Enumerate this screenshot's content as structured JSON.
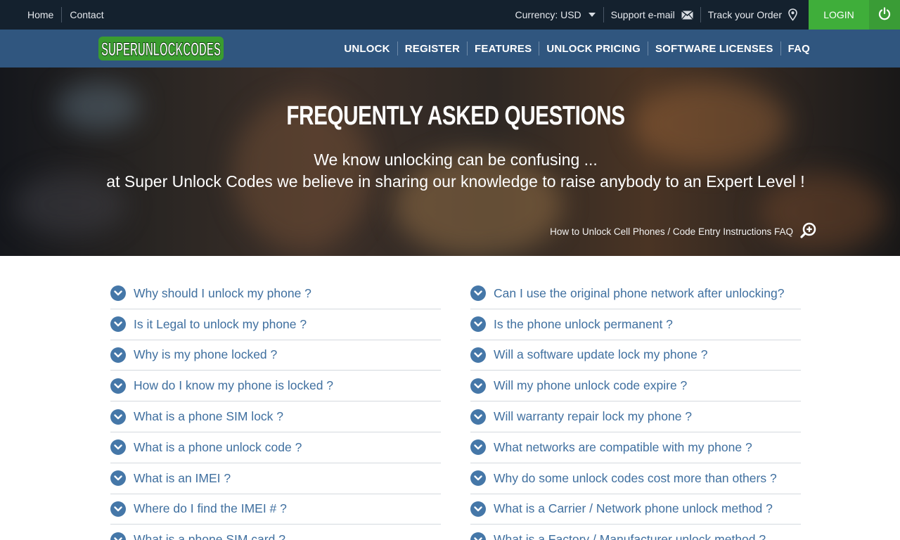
{
  "topbar": {
    "links": [
      "Home",
      "Contact"
    ],
    "currency_label": "Currency: USD",
    "support_label": "Support e-mail",
    "track_label": "Track your Order",
    "login_label": "LOGIN"
  },
  "brand": {
    "logo_text": "SUPERUNLOCKCODES"
  },
  "nav": {
    "items": [
      "UNLOCK",
      "REGISTER",
      "FEATURES",
      "UNLOCK PRICING",
      "SOFTWARE LICENSES",
      "FAQ"
    ]
  },
  "hero": {
    "title": "FREQUENTLY ASKED QUESTIONS",
    "subtitle_line1": "We know unlocking can be confusing ...",
    "subtitle_line2": "at Super Unlock Codes we believe in sharing our knowledge to raise anybody to an Expert Level !",
    "link_text": "How to Unlock Cell Phones / Code Entry Instructions FAQ"
  },
  "faq": {
    "left": [
      "Why should I unlock my phone ?",
      "Is it Legal to unlock my phone ?",
      "Why is my phone locked ?",
      "How do I know my phone is locked ?",
      "What is a phone SIM lock ?",
      "What is a phone unlock code ?",
      "What is an IMEI ?",
      "Where do I find the IMEI # ?",
      "What is a phone SIM card ?"
    ],
    "right": [
      "Can I use the original phone network after unlocking?",
      "Is the phone unlock permanent ?",
      "Will a software update lock my phone ?",
      "Will my phone unlock code expire ?",
      "Will warranty repair lock my phone ?",
      "What networks are compatible with my phone ?",
      "Why do some unlock codes cost more than others ?",
      "What is a Carrier / Network phone unlock method ?",
      "What is a Factory / Manufacturer unlock method ?"
    ]
  },
  "colors": {
    "topbar_bg": "#14212e",
    "navbar_bg": "#30567f",
    "login_green": "#3fae3a",
    "faq_link_blue": "#3f6f9f",
    "chevron_blue": "#4577a8"
  }
}
